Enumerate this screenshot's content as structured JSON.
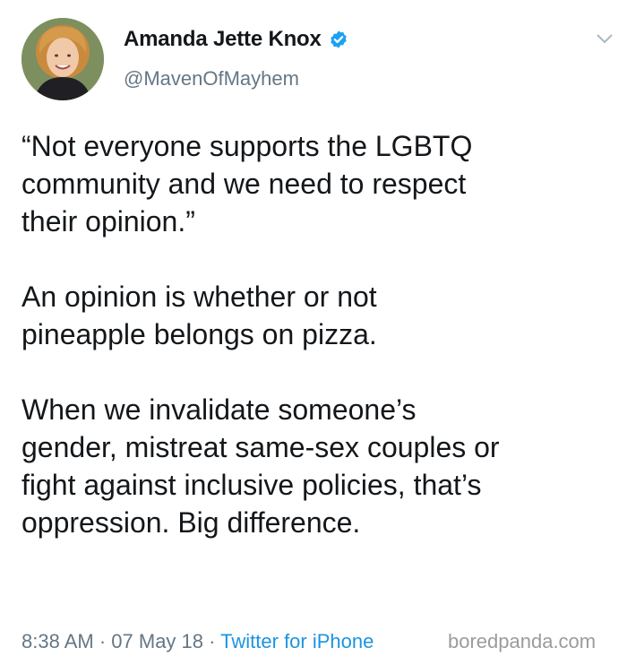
{
  "author": {
    "display_name": "Amanda Jette Knox",
    "handle": "@MavenOfMayhem",
    "verified_icon": "verified-badge-icon",
    "avatar": "avatar"
  },
  "tweet": {
    "paragraphs": [
      "“Not everyone supports the LGBTQ\ncommunity and we need to respect\ntheir opinion.”",
      "An opinion is whether or not\npineapple belongs on pizza.",
      "When we invalidate someone’s\ngender, mistreat same-sex couples or\nfight against inclusive policies, that’s\noppression. Big difference."
    ]
  },
  "meta": {
    "time": "8:38 AM",
    "sep1": " · ",
    "date": "07 May 18",
    "sep2": " · ",
    "source": "Twitter for iPhone"
  },
  "watermark": "boredpanda.com",
  "colors": {
    "text": "#14171a",
    "secondary": "#657786",
    "link": "#1b95e0",
    "verified": "#1da1f2"
  }
}
